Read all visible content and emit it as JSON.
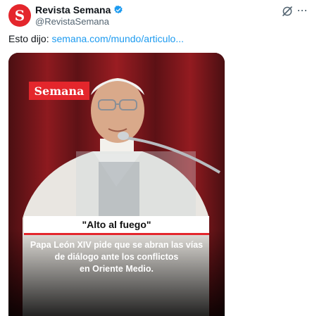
{
  "author": {
    "avatar_letter": "S",
    "display_name": "Revista Semana",
    "handle": "@RevistaSemana",
    "verified": true
  },
  "header_icons": [
    "grok-icon",
    "more-icon"
  ],
  "tweet": {
    "text": "Esto dijo: ",
    "link": "semana.com/mundo/articulo..."
  },
  "media": {
    "logo": "Semana",
    "headline": "\"Alto al fuego\"",
    "caption_lines": [
      "Papa León XIV pide que se abran las vías",
      "de diálogo ante los conflictos",
      "en Oriente Medio."
    ]
  },
  "colors": {
    "brand_red": "#e4262c",
    "link_blue": "#1d9bf0",
    "verified_blue": "#1d9bf0"
  }
}
